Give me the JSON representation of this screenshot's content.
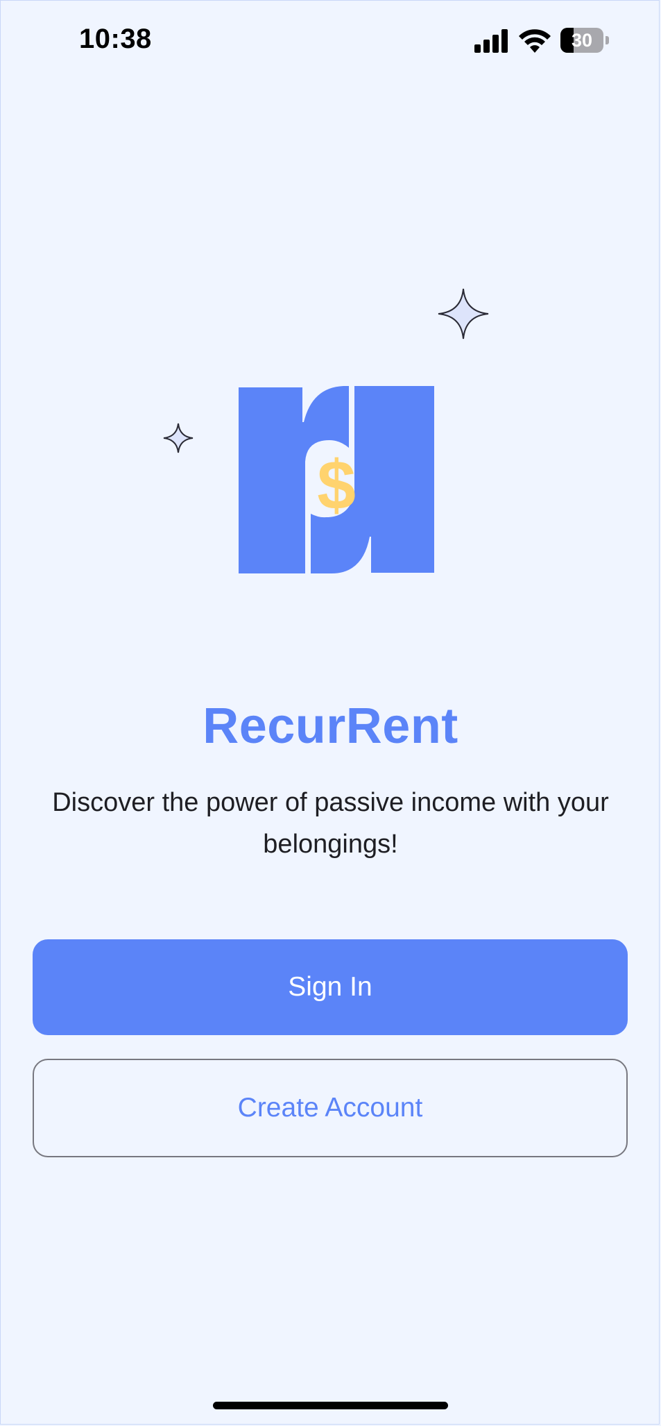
{
  "status_bar": {
    "time": "10:38",
    "battery_level": "30",
    "battery_fraction": 0.3,
    "icons": [
      "signal-icon",
      "wifi-icon",
      "battery-icon"
    ]
  },
  "logo": {
    "icon": "recurrent-logo-icon",
    "symbol": "$"
  },
  "app_title": "RecurRent",
  "tagline": "Discover the power of passive income with your belongings!",
  "buttons": {
    "sign_in": "Sign In",
    "create_account": "Create Account"
  },
  "colors": {
    "brand_blue": "#5b84f8",
    "coin_yellow": "#ffd36e",
    "background": "#f0f5ff",
    "sparkle_fill": "#dde4fb"
  }
}
